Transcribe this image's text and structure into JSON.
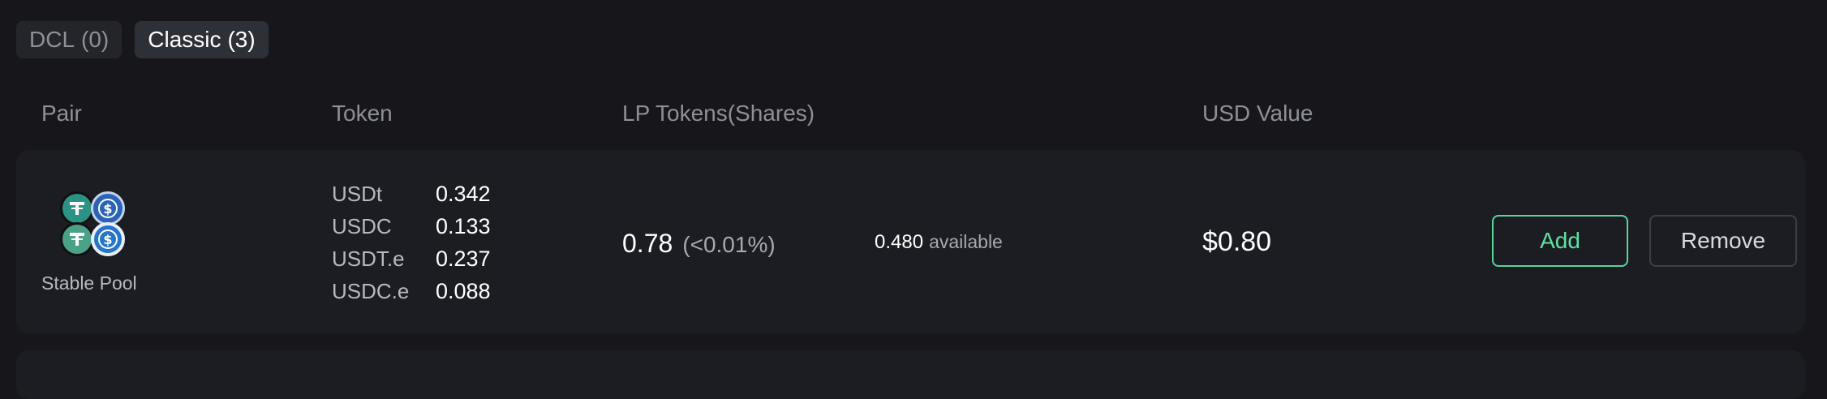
{
  "tabs": [
    {
      "label": "DCL",
      "count": "(0)",
      "active": false
    },
    {
      "label": "Classic",
      "count": "(3)",
      "active": true
    }
  ],
  "table": {
    "headers": {
      "pair": "Pair",
      "token": "Token",
      "lp_tokens": "LP Tokens(Shares)",
      "usd_value": "USD Value"
    },
    "rows": [
      {
        "pair_name": "Stable Pool",
        "pair_icons": [
          "usdt-icon",
          "usdc-icon",
          "usdt-icon",
          "usdc-icon"
        ],
        "tokens": [
          {
            "symbol": "USDt",
            "amount": "0.342"
          },
          {
            "symbol": "USDC",
            "amount": "0.133"
          },
          {
            "symbol": "USDT.e",
            "amount": "0.237"
          },
          {
            "symbol": "USDC.e",
            "amount": "0.088"
          }
        ],
        "lp_amount": "0.78",
        "lp_share": "(<0.01%)",
        "available_amount": "0.480",
        "available_label": "available",
        "usd_value": "$0.80",
        "add_label": "Add",
        "remove_label": "Remove"
      }
    ]
  },
  "colors": {
    "background": "#17171b",
    "card": "#1c1d22",
    "accent_green": "#5ee0a2",
    "usdt_green": "#2b9383",
    "usdc_blue": "#2775ca"
  }
}
